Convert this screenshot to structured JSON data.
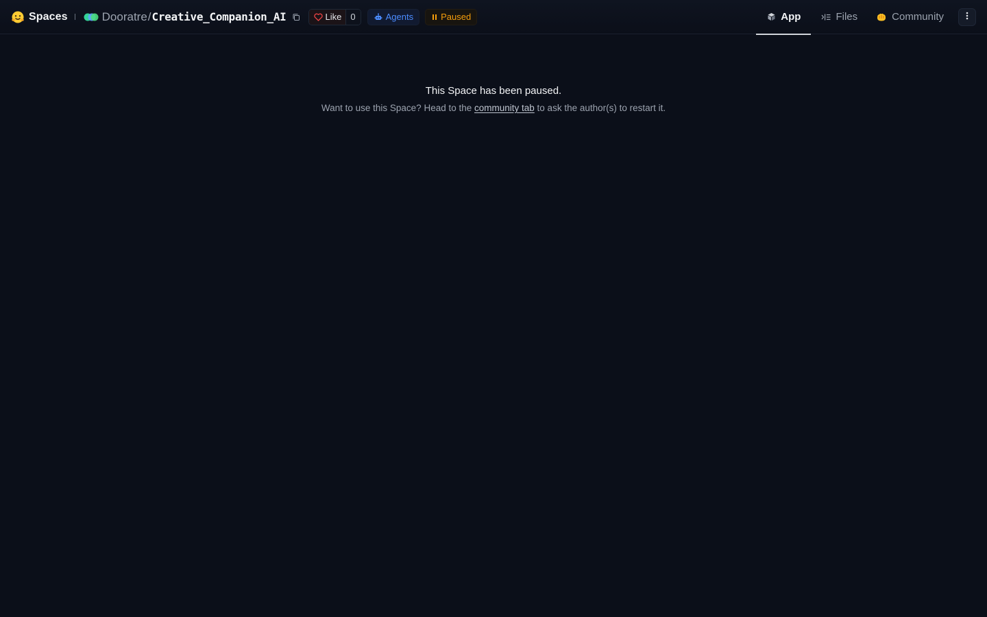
{
  "header": {
    "logo_icon": "hugging-face-emoji-icon",
    "section_label": "Spaces",
    "owner": "Dooratre",
    "separator": "/",
    "repo_name": "Creative_Companion_AI",
    "like_label": "Like",
    "like_count": "0",
    "agents_label": "Agents",
    "status_label": "Paused"
  },
  "tabs": [
    {
      "label": "App",
      "icon": "cube-icon",
      "active": true
    },
    {
      "label": "Files",
      "icon": "files-list-icon",
      "active": false
    },
    {
      "label": "Community",
      "icon": "community-hands-icon",
      "active": false
    }
  ],
  "main": {
    "title": "This Space has been paused.",
    "desc_before": "Want to use this Space? Head to the ",
    "desc_link": "community tab",
    "desc_after": " to ask the author(s) to restart it."
  },
  "colors": {
    "background": "#0b0f19",
    "agents_accent": "#4b8cff",
    "paused_accent": "#f59e0b",
    "heart": "#ef4444"
  }
}
